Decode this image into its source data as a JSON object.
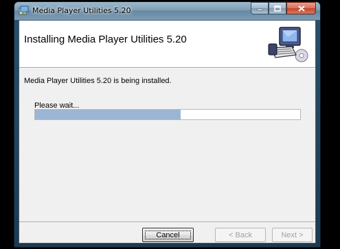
{
  "window": {
    "title": "Media Player Utilities 5.20",
    "app_icon": "installer-icon",
    "caption_buttons": [
      "minimize-icon",
      "maximize-icon",
      "close-icon"
    ]
  },
  "banner": {
    "title": "Installing Media Player Utilities 5.20",
    "icon": "computer-setup-icon"
  },
  "body": {
    "status_text": "Media Player Utilities 5.20 is being installed.",
    "wait_text": "Please wait...",
    "progress": 0.55,
    "progress_color": "#9cb5d4"
  },
  "buttons": {
    "cancel": "Cancel",
    "back": "< Back",
    "next": "Next >"
  }
}
